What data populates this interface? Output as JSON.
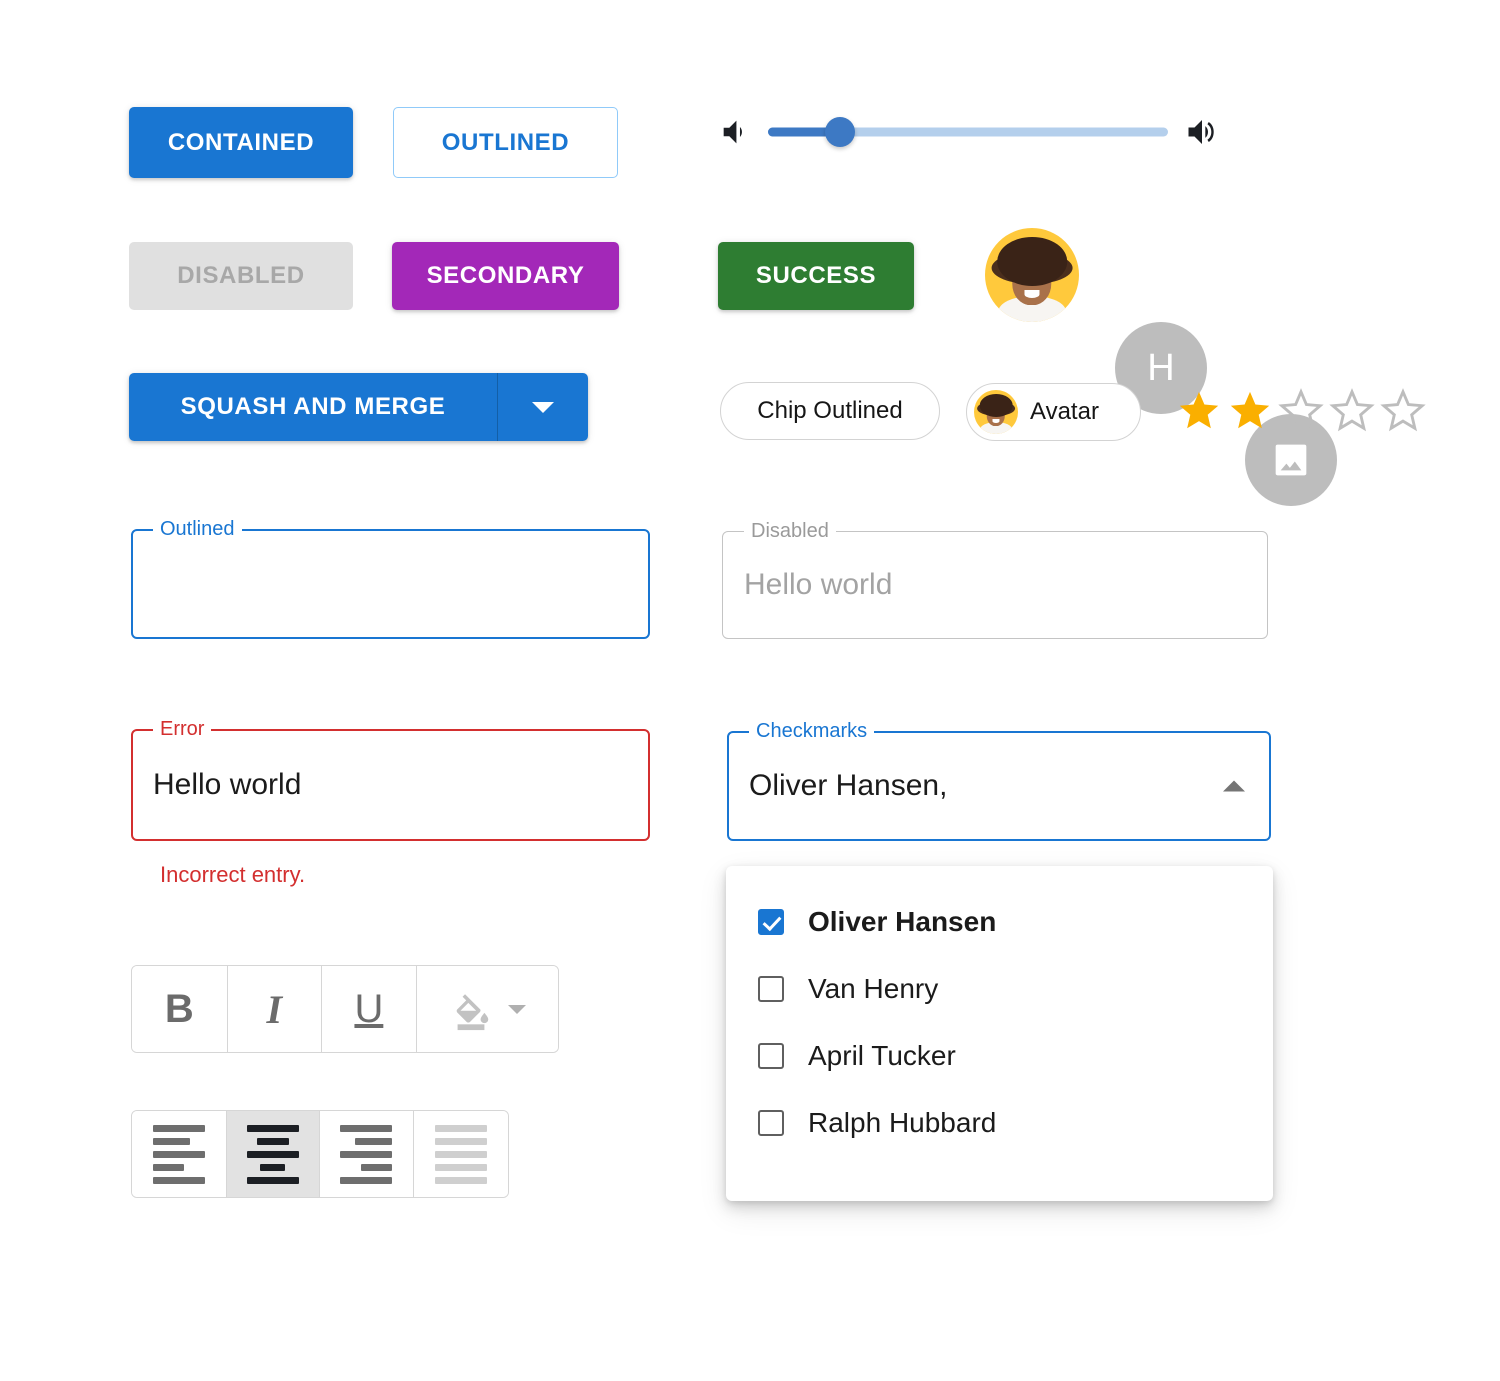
{
  "buttons": {
    "contained": "CONTAINED",
    "outlined": "OUTLINED",
    "disabled": "DISABLED",
    "secondary": "SECONDARY",
    "success": "SUCCESS",
    "split_main": "SQUASH AND MERGE"
  },
  "slider": {
    "value_percent": 18,
    "min_icon": "volume-down-icon",
    "max_icon": "volume-up-icon",
    "track_color": "#b4cfec",
    "fill_color": "#3d79c4"
  },
  "avatars": {
    "photo_alt": "photo-avatar",
    "letter": "H",
    "image_placeholder": "image-icon"
  },
  "chips": {
    "outlined_label": "Chip Outlined",
    "avatar_label": "Avatar"
  },
  "rating": {
    "value": 2,
    "max": 5,
    "filled_color": "#faaf00",
    "empty_color": "#bdbdbd"
  },
  "fields": {
    "outlined": {
      "label": "Outlined",
      "value": "",
      "helper": ""
    },
    "disabled": {
      "label": "Disabled",
      "value": "Hello world",
      "helper": ""
    },
    "error": {
      "label": "Error",
      "value": "Hello world",
      "helper": "Incorrect entry."
    },
    "checkmarks": {
      "label": "Checkmarks",
      "value": "Oliver Hansen,"
    }
  },
  "menu": {
    "items": [
      {
        "label": "Oliver Hansen",
        "checked": true
      },
      {
        "label": "Van Henry",
        "checked": false
      },
      {
        "label": "April Tucker",
        "checked": false
      },
      {
        "label": "Ralph Hubbard",
        "checked": false
      }
    ]
  },
  "format_toolbar": {
    "items": [
      {
        "name": "bold",
        "glyph": "B",
        "state": "normal"
      },
      {
        "name": "italic",
        "glyph": "I",
        "state": "normal"
      },
      {
        "name": "underlined",
        "glyph": "U",
        "state": "normal"
      },
      {
        "name": "color-fill",
        "glyph": "",
        "state": "normal"
      }
    ]
  },
  "align_toolbar": {
    "items": [
      {
        "name": "align-left",
        "state": "normal"
      },
      {
        "name": "align-center",
        "state": "selected"
      },
      {
        "name": "align-right",
        "state": "normal"
      },
      {
        "name": "align-justify",
        "state": "disabled"
      }
    ]
  },
  "colors": {
    "primary": "#1976d2",
    "secondary": "#a328b8",
    "success": "#2e7d32",
    "error": "#d32f2f",
    "disabled_bg": "#e0e0e0"
  }
}
